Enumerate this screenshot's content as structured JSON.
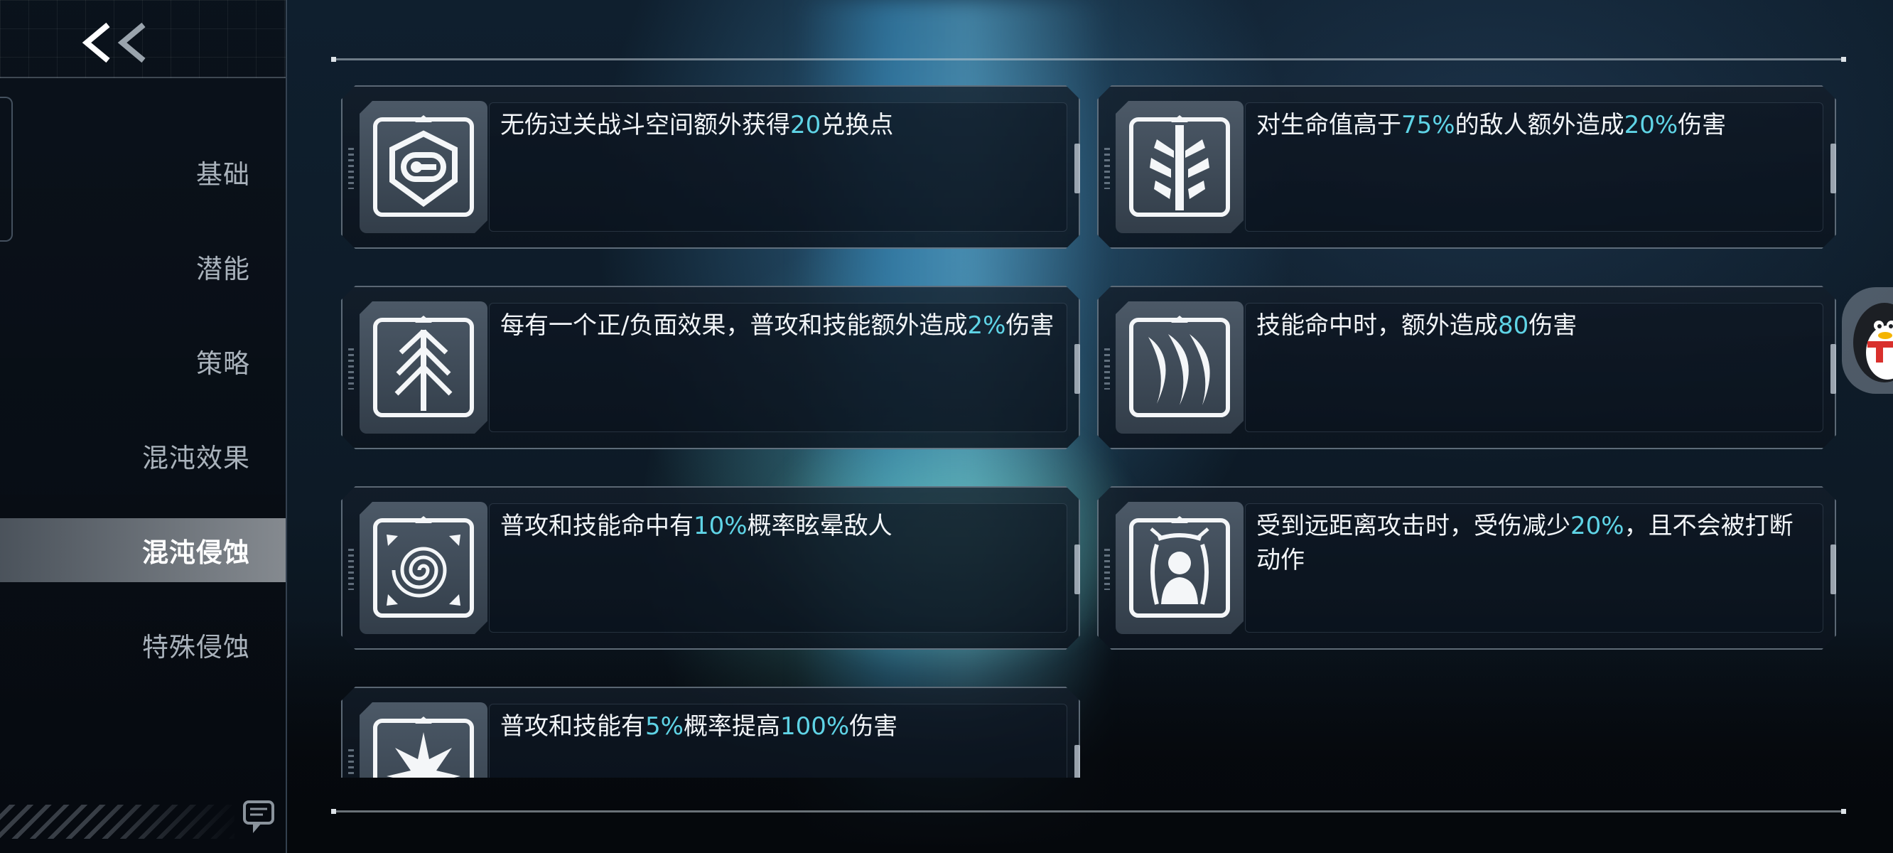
{
  "sidebar": {
    "back_label": "<<",
    "items": [
      {
        "label": "基础",
        "active": false
      },
      {
        "label": "潜能",
        "active": false
      },
      {
        "label": "策略",
        "active": false
      },
      {
        "label": "混沌效果",
        "active": false
      },
      {
        "label": "混沌侵蚀",
        "active": true
      },
      {
        "label": "特殊侵蚀",
        "active": false
      }
    ]
  },
  "cards": [
    {
      "icon": "hexagon-token-icon",
      "parts": [
        "无伤过关战斗空间额外获得",
        "20",
        "兑换点"
      ]
    },
    {
      "icon": "sword-crest-icon",
      "parts": [
        "对生命值高于",
        "75%",
        "的敌人额外造成",
        "20%",
        "伤害"
      ]
    },
    {
      "icon": "arrow-tree-icon",
      "parts": [
        "每有一个正/负面效果，普攻和技能额外造成",
        "2%",
        "伤害"
      ]
    },
    {
      "icon": "claw-slash-icon",
      "parts": [
        "技能命中时，额外造成",
        "80",
        "伤害"
      ]
    },
    {
      "icon": "spiral-vortex-icon",
      "parts": [
        "普攻和技能命中有",
        "10%",
        "概率眩晕敌人"
      ]
    },
    {
      "icon": "shielded-person-icon",
      "parts": [
        "受到远距离攻击时，受伤减少",
        "20%",
        "，且不会被打断动作"
      ]
    },
    {
      "icon": "spiky-burst-icon",
      "parts": [
        "普攻和技能有",
        "5%",
        "概率提高",
        "100%",
        "伤害"
      ]
    }
  ],
  "colors": {
    "highlight": "#5fd4e6",
    "text": "#f2f5f8",
    "active_nav_text": "#ffffff",
    "nav_text": "#a9b2bb"
  }
}
